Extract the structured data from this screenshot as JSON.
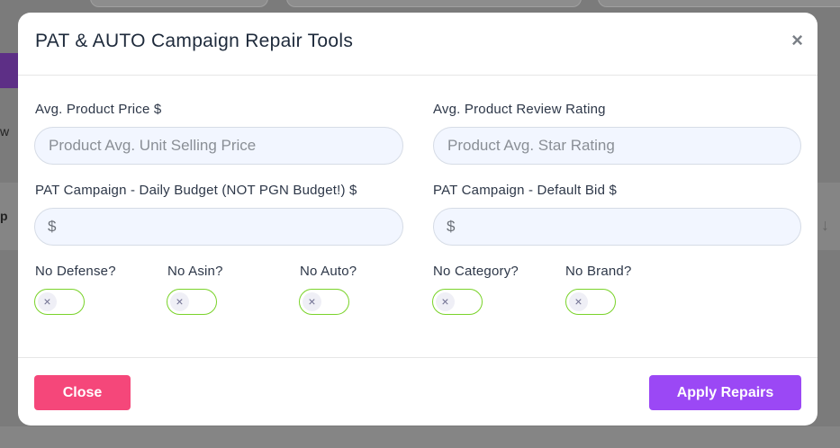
{
  "modal": {
    "title": "PAT & AUTO Campaign Repair Tools",
    "close_icon": "×"
  },
  "fields": {
    "avg_price": {
      "label": "Avg. Product Price $",
      "placeholder": "Product Avg. Unit Selling Price"
    },
    "avg_rating": {
      "label": "Avg. Product Review Rating",
      "placeholder": "Product Avg. Star Rating"
    },
    "daily_budget": {
      "label": "PAT Campaign - Daily Budget (NOT PGN Budget!) $",
      "prefix": "$"
    },
    "default_bid": {
      "label": "PAT Campaign - Default Bid $",
      "prefix": "$"
    }
  },
  "toggles": [
    {
      "label": "No Defense?",
      "state": "off",
      "icon": "×"
    },
    {
      "label": "No Asin?",
      "state": "off",
      "icon": "×"
    },
    {
      "label": "No Auto?",
      "state": "off",
      "icon": "×"
    },
    {
      "label": "No Category?",
      "state": "off",
      "icon": "×"
    },
    {
      "label": "No Brand?",
      "state": "off",
      "icon": "×"
    }
  ],
  "footer": {
    "close_label": "Close",
    "apply_label": "Apply Repairs"
  },
  "background": {
    "fragment_w": "w",
    "fragment_p": "p",
    "fragment_arrow": "↓"
  },
  "colors": {
    "toggle_border": "#7ad32a",
    "close_button": "#f5477a",
    "apply_button": "#9b48f5"
  }
}
